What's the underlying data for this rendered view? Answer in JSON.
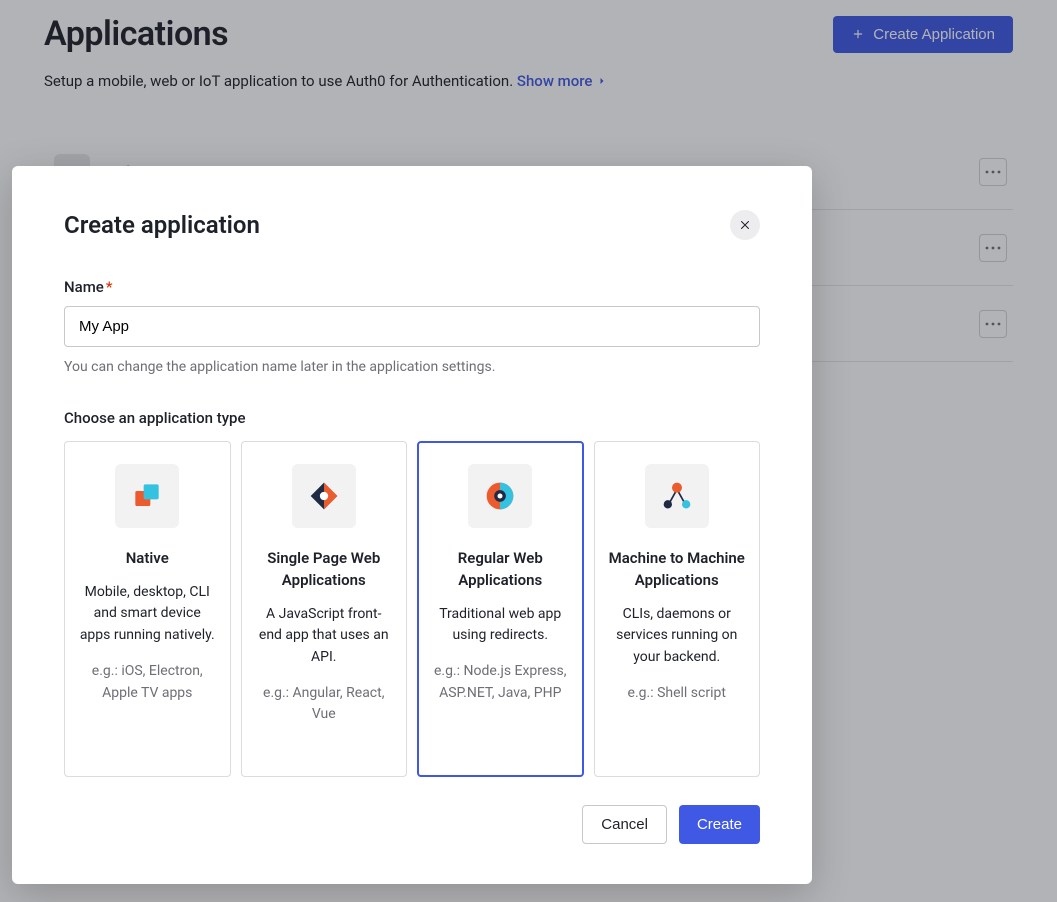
{
  "header": {
    "title": "Applications",
    "create_button": "Create Application",
    "subtitle_prefix": "Setup a mobile, web or IoT application to use Auth0 for Authentication. ",
    "show_more": "Show more"
  },
  "apps": [
    {
      "name": "Default App"
    },
    {
      "name": ""
    },
    {
      "name": ""
    }
  ],
  "modal": {
    "title": "Create application",
    "name_label": "Name",
    "required_mark": "*",
    "name_value": "My App",
    "name_help": "You can change the application name later in the application settings.",
    "type_label": "Choose an application type",
    "types": [
      {
        "title": "Native",
        "desc": "Mobile, desktop, CLI and smart device apps running natively.",
        "eg": "e.g.: iOS, Electron, Apple TV apps",
        "selected": false
      },
      {
        "title": "Single Page Web Applications",
        "desc": "A JavaScript front-end app that uses an API.",
        "eg": "e.g.: Angular, React, Vue",
        "selected": false
      },
      {
        "title": "Regular Web Applications",
        "desc": "Traditional web app using redirects.",
        "eg": "e.g.: Node.js Express, ASP.NET, Java, PHP",
        "selected": true
      },
      {
        "title": "Machine to Machine Applications",
        "desc": "CLIs, daemons or services running on your backend.",
        "eg": "e.g.: Shell script",
        "selected": false
      }
    ],
    "cancel": "Cancel",
    "create": "Create"
  }
}
